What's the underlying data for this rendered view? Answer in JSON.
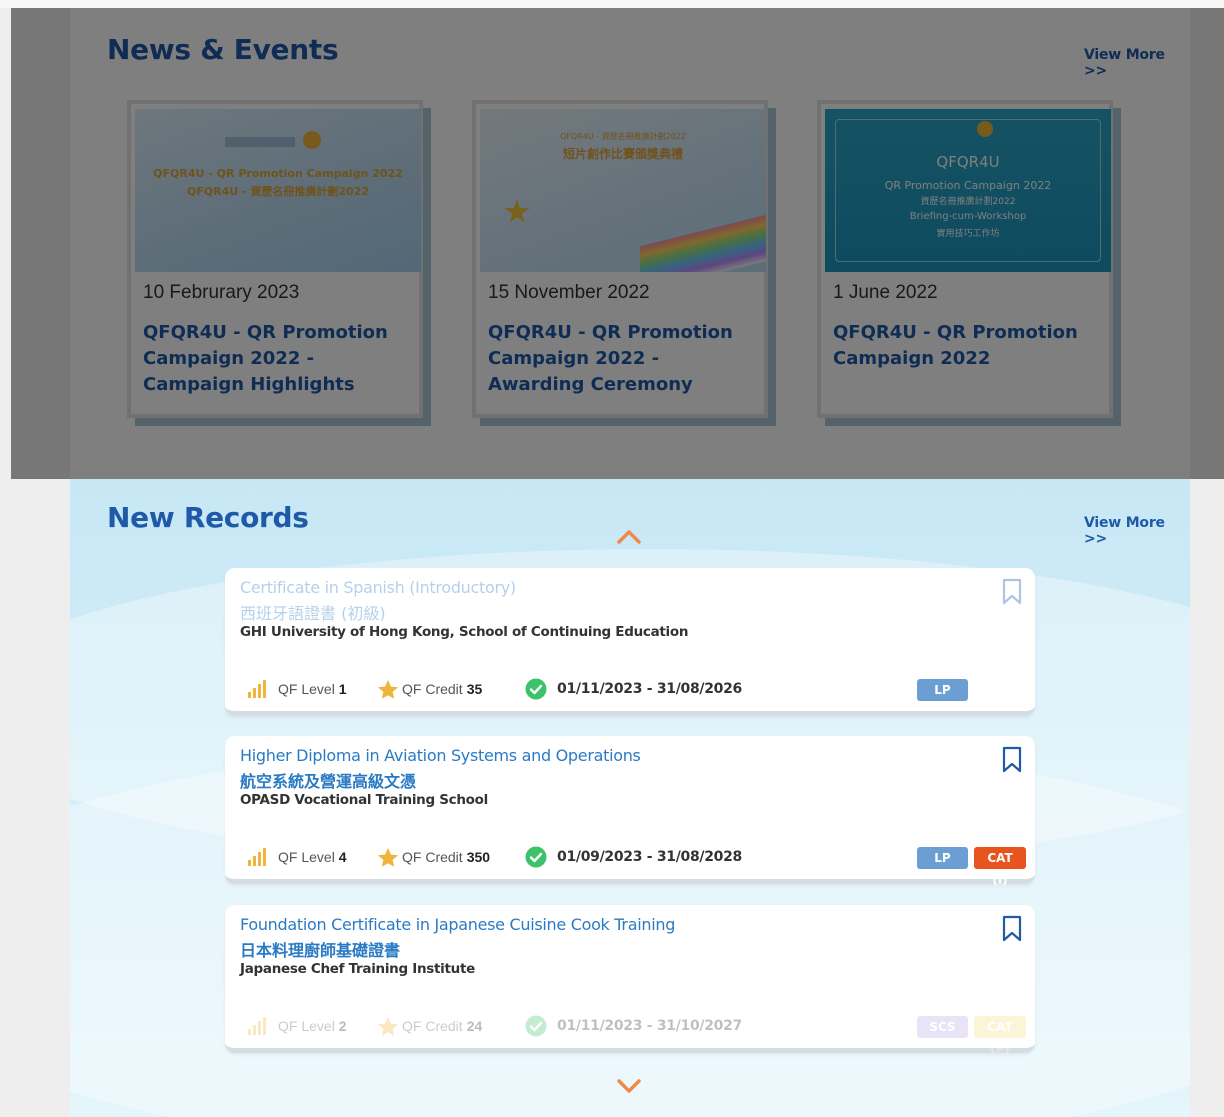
{
  "news": {
    "title": "News & Events",
    "view_more": "View More >>",
    "items": [
      {
        "date": "10 Februrary 2023",
        "headline": "QFQR4U - QR Promotion Campaign 2022 - Campaign Highlights",
        "thumb_line1": "QFQR4U - QR Promotion Campaign 2022",
        "thumb_line2": "QFQR4U - 資歷名冊推廣計劃2022"
      },
      {
        "date": "15 November 2022",
        "headline": "QFQR4U - QR Promotion Campaign 2022 - Awarding Ceremony",
        "thumb_line1": "QFQR4U - 資歷名冊推廣計劃2022",
        "thumb_line2": "短片創作比賽頒獎典禮"
      },
      {
        "date": "1 June 2022",
        "headline": "QFQR4U - QR Promotion Campaign 2022",
        "thumb_line1": "QFQR4U",
        "thumb_line2": "QR Promotion Campaign 2022",
        "thumb_line3": "資歷名冊推廣計劃2022",
        "thumb_line4": "Briefing-cum-Workshop",
        "thumb_line5": "實用技巧工作坊"
      }
    ]
  },
  "records": {
    "title": "New Records",
    "view_more": "View More >>",
    "items": [
      {
        "title_en": "Certificate in Spanish (Introductory)",
        "title_zh": "西班牙語證書 (初級)",
        "provider": "GHI University of Hong Kong, School of Continuing Education",
        "level_label": "QF Level",
        "level": "1",
        "credit_label": "QF Credit",
        "credit": "35",
        "period": "01/11/2023 - 31/08/2026",
        "badges": [
          "LP"
        ]
      },
      {
        "title_en": "Higher Diploma in Aviation Systems and Operations",
        "title_zh": "航空系統及營運高級文憑",
        "provider": "OPASD Vocational Training School",
        "level_label": "QF Level",
        "level": "4",
        "credit_label": "QF Credit",
        "credit": "350",
        "period": "01/09/2023 - 31/08/2028",
        "badges": [
          "LP",
          "CAT (I)"
        ]
      },
      {
        "title_en": "Foundation Certificate in Japanese Cuisine Cook Training",
        "title_zh": "日本料理廚師基礎證書",
        "provider": "Japanese Chef Training Institute",
        "level_label": "QF Level",
        "level": "2",
        "credit_label": "QF Credit",
        "credit": "24",
        "period": "01/11/2023 - 31/10/2027",
        "badges": [
          "SCS",
          "CAT (P)"
        ]
      }
    ]
  },
  "colors": {
    "brand_blue": "#1e5aa8",
    "link_blue": "#2a7bc4",
    "badge_lp": "#6b9fd4",
    "badge_cat_i": "#e8541e",
    "badge_scs": "#b9a6e8",
    "badge_cat_p": "#f2dc7a",
    "chevron": "#f08a4b"
  }
}
